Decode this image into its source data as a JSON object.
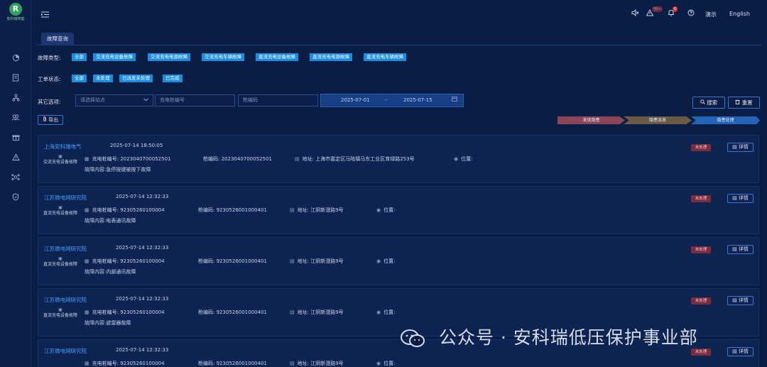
{
  "logo": {
    "mark": "R",
    "text": "安科瑞电能"
  },
  "sidebar": {
    "icons": [
      "chart-pie-icon",
      "document-icon",
      "org-chart-icon",
      "users-icon",
      "gift-icon",
      "warning-icon",
      "network-icon",
      "shield-icon"
    ]
  },
  "topbar": {
    "alarm_badge": "99+",
    "notice_badge": "0",
    "demo_label": "演示",
    "language_label": "English"
  },
  "tab": {
    "label": "故障查询"
  },
  "filters": {
    "fault_type_label": "故障类型:",
    "fault_types": [
      "全部",
      "交流充电设备故障",
      "交流充电电源故障",
      "交流充电车辆故障",
      "直流充电设备故障",
      "直流充电电源故障",
      "直流充电车辆故障"
    ],
    "order_status_label": "工单状态:",
    "order_statuses": [
      "全部",
      "未处理",
      "已派发未处理",
      "已完成"
    ],
    "other_label": "其它选项:",
    "station_placeholder": "请选择站点",
    "pile_placeholder": "充电桩编号",
    "gun_placeholder": "枪编码",
    "date_start": "2025-07-01",
    "date_separator": "~",
    "date_end": "2025-07-15",
    "search_label": "搜索",
    "reset_label": "重置"
  },
  "export_label": "导出",
  "steps": [
    "发现隐患",
    "隐患派发",
    "隐患处理"
  ],
  "records": [
    {
      "station": "上海安科瑞电气",
      "time": "2025-07-14 18:50:05",
      "type": "交流充电设备故障",
      "pile_label": "充电桩编号:",
      "pile": "2023040700052501",
      "gun_label": "枪编码:",
      "gun": "2023040700052501",
      "address_label": "地址:",
      "address": "上海市嘉定区马陆镇马东工业区育绿路253号",
      "position_label": "位置:",
      "content": "故障内容:急停按键被按下故障",
      "status": "未处理",
      "detail_label": "详情"
    },
    {
      "station": "江苏微电网研究院",
      "time": "2025-07-14 12:32:33",
      "type": "直流充电设备故障",
      "pile_label": "充电桩编号:",
      "pile": "92305260100004",
      "gun_label": "枪编码:",
      "gun": "9230526001000401",
      "address_label": "地址:",
      "address": "江阴新澄路9号",
      "position_label": "位置:",
      "content": "故障内容:电表通讯故障",
      "status": "未处理",
      "detail_label": "详情"
    },
    {
      "station": "江苏微电网研究院",
      "time": "2025-07-14 12:32:33",
      "type": "直流充电设备故障",
      "pile_label": "充电桩编号:",
      "pile": "92305260100004",
      "gun_label": "枪编码:",
      "gun": "9230526001000401",
      "address_label": "地址:",
      "address": "江阴新澄路9号",
      "position_label": "位置:",
      "content": "故障内容:内部通讯故障",
      "status": "未处理",
      "detail_label": "详情"
    },
    {
      "station": "江苏微电网研究院",
      "time": "2025-07-14 12:32:33",
      "type": "直流充电设备故障",
      "pile_label": "充电桩编号:",
      "pile": "92305260100004",
      "gun_label": "枪编码:",
      "gun": "9230526001000401",
      "address_label": "地址:",
      "address": "江阴新澄路9号",
      "position_label": "位置:",
      "content": "故障内容:避雷器故障",
      "status": "未处理",
      "detail_label": "详情"
    },
    {
      "station": "江苏微电网研究院",
      "time": "2025-07-14 12:32:33",
      "type": "直流充电设备故障",
      "pile_label": "充电桩编号:",
      "pile": "92305260100004",
      "gun_label": "枪编码:",
      "gun": "9230526001000401",
      "address_label": "地址:",
      "address": "江阴新澄路9号",
      "position_label": "位置:",
      "content": "",
      "status": "未处理",
      "detail_label": "详情"
    }
  ],
  "watermark": {
    "text": "公众号 · 安科瑞低压保护事业部"
  },
  "colors": {
    "accent": "#1b8de0",
    "background": "#0a1d44",
    "link": "#3fa0ff",
    "status_pending": "#7b2c3d"
  }
}
